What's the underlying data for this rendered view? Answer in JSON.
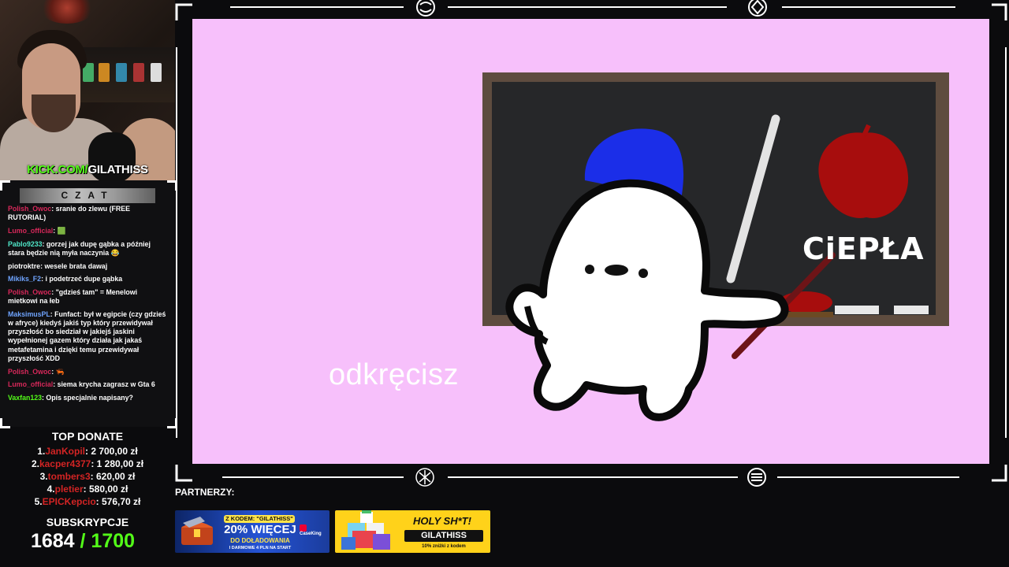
{
  "stream": {
    "channel_url_prefix": "KICK.COM/",
    "channel_name": "GILATHISS"
  },
  "chat": {
    "title": "CZAT",
    "messages": [
      {
        "user": "Polish_Owoc",
        "user_color": "#d7285a",
        "text": "sranie do zlewu (FREE RUTORIAL)"
      },
      {
        "user": "Lumo_official",
        "user_color": "#d7285a",
        "text": "🟩"
      },
      {
        "user": "Pablo9233",
        "user_color": "#4fe6c8",
        "text": "gorzej jak dupę gąbka a później stara będzie nią myła naczynia 😂"
      },
      {
        "user": "piotroktre",
        "user_color": "#ffffff",
        "text": "wesele brata dawaj"
      },
      {
        "user": "Mikiks_F2",
        "user_color": "#6fa4ff",
        "text": "i podetrzeć dupe gąbka"
      },
      {
        "user": "Polish_Owoc",
        "user_color": "#d7285a",
        "text": "\"gdzieś tam\" = Menelowi mietkowi na łeb"
      },
      {
        "user": "MaksimusPL",
        "user_color": "#6fa4ff",
        "text": "Funfact: był w egipcie (czy gdzieś w afryce) kiedyś jakiś typ który przewidywał przyszłość bo siedział w jakiejś jaskini wypełnionej gazem który działa jak jakaś metafetamina i dzięki temu przewidywał przyszłość XDD"
      },
      {
        "user": "Polish_Owoc",
        "user_color": "#d7285a",
        "text": "🦐"
      },
      {
        "user": "Lumo_official",
        "user_color": "#d7285a",
        "text": "siema krycha zagrasz w Gta 6"
      },
      {
        "user": "Vaxfan123",
        "user_color": "#53fc18",
        "text": "Opis specjalnie napisany?"
      }
    ]
  },
  "top_donate": {
    "title": "TOP DONATE",
    "entries": [
      {
        "rank": "1.",
        "name": "JanKopil",
        "amount": ": 2 700,00 zł"
      },
      {
        "rank": "2.",
        "name": "kacper4377",
        "amount": ": 1 280,00 zł"
      },
      {
        "rank": "3.",
        "name": "tombers3",
        "amount": ": 620,00 zł"
      },
      {
        "rank": "4.",
        "name": "pletier",
        "amount": ": 580,00 zł"
      },
      {
        "rank": "5.",
        "name": "EPICKepcio",
        "amount": ": 576,70 zł"
      }
    ]
  },
  "subs": {
    "title": "SUBSKRYPCJE",
    "current": "1684",
    "goal": "/ 1700"
  },
  "video": {
    "subtitle": "odkręcisz",
    "board_text": "CiEPŁA"
  },
  "partners": {
    "label": "PARTNERZY:",
    "casedrop": {
      "code_line": "Z KODEM: \"GILATHISS\"",
      "headline": "20% WIĘCEJ",
      "line2": "DO DOŁADOWANIA",
      "line3": "I DARMOWE 4 PLN NA START",
      "logo": "CaseKing"
    },
    "holy": {
      "headline": "HOLY SH*T!",
      "code": "GILATHISS",
      "discount": "10% zniżki z kodem"
    }
  },
  "colors": {
    "kick_green": "#53fc18",
    "video_bg": "#f7c0fb",
    "donor_red": "#d32424"
  }
}
